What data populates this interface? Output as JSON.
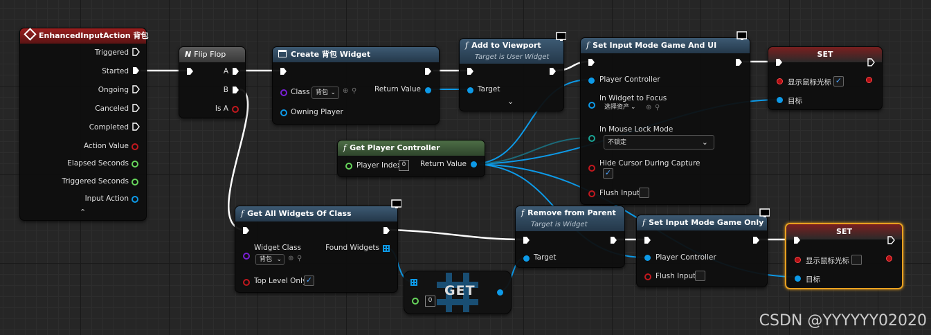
{
  "nodes": {
    "event": {
      "title": "EnhancedInputAction 背包",
      "outputs": [
        "Triggered",
        "Started",
        "Ongoing",
        "Canceled",
        "Completed",
        "Action Value",
        "Elapsed Seconds",
        "Triggered Seconds",
        "Input Action"
      ]
    },
    "flipflop": {
      "title": "Flip Flop",
      "out_a": "A",
      "out_b": "B",
      "out_isa": "Is A"
    },
    "create_widget": {
      "title": "Create 背包 Widget",
      "class_label": "Class",
      "class_value": "背包",
      "owning_player": "Owning Player",
      "return_value": "Return Value"
    },
    "add_viewport": {
      "title": "Add to Viewport",
      "subtitle": "Target is User Widget",
      "target": "Target"
    },
    "set_input_ui": {
      "title": "Set Input Mode Game And UI",
      "player_controller": "Player Controller",
      "widget_focus": "In Widget to Focus",
      "widget_focus_value": "选择资产",
      "mouse_lock": "In Mouse Lock Mode",
      "mouse_lock_value": "不锁定",
      "hide_cursor": "Hide Cursor During Capture",
      "flush_input": "Flush Input"
    },
    "set1": {
      "title": "SET",
      "show_cursor": "显示鼠标光标",
      "target": "目标"
    },
    "get_pc": {
      "title": "Get Player Controller",
      "player_index": "Player Index",
      "player_index_value": "0",
      "return_value": "Return Value"
    },
    "get_all_widgets": {
      "title": "Get All Widgets Of Class",
      "widget_class": "Widget Class",
      "widget_class_value": "背包",
      "found_widgets": "Found Widgets",
      "top_level_only": "Top Level Only"
    },
    "get_node": {
      "title": "GET",
      "index_value": "0"
    },
    "remove_parent": {
      "title": "Remove from Parent",
      "subtitle": "Target is Widget",
      "target": "Target"
    },
    "set_input_game": {
      "title": "Set Input Mode Game Only",
      "player_controller": "Player Controller",
      "flush_input": "Flush Input"
    },
    "set2": {
      "title": "SET",
      "show_cursor": "显示鼠标光标",
      "target": "目标"
    }
  },
  "watermark": "CSDN @YYYYYY02020",
  "colors": {
    "exec": "#ffffff",
    "object": "#0d9ae8",
    "struct": "#66d45b",
    "selected": "#e8a020"
  }
}
